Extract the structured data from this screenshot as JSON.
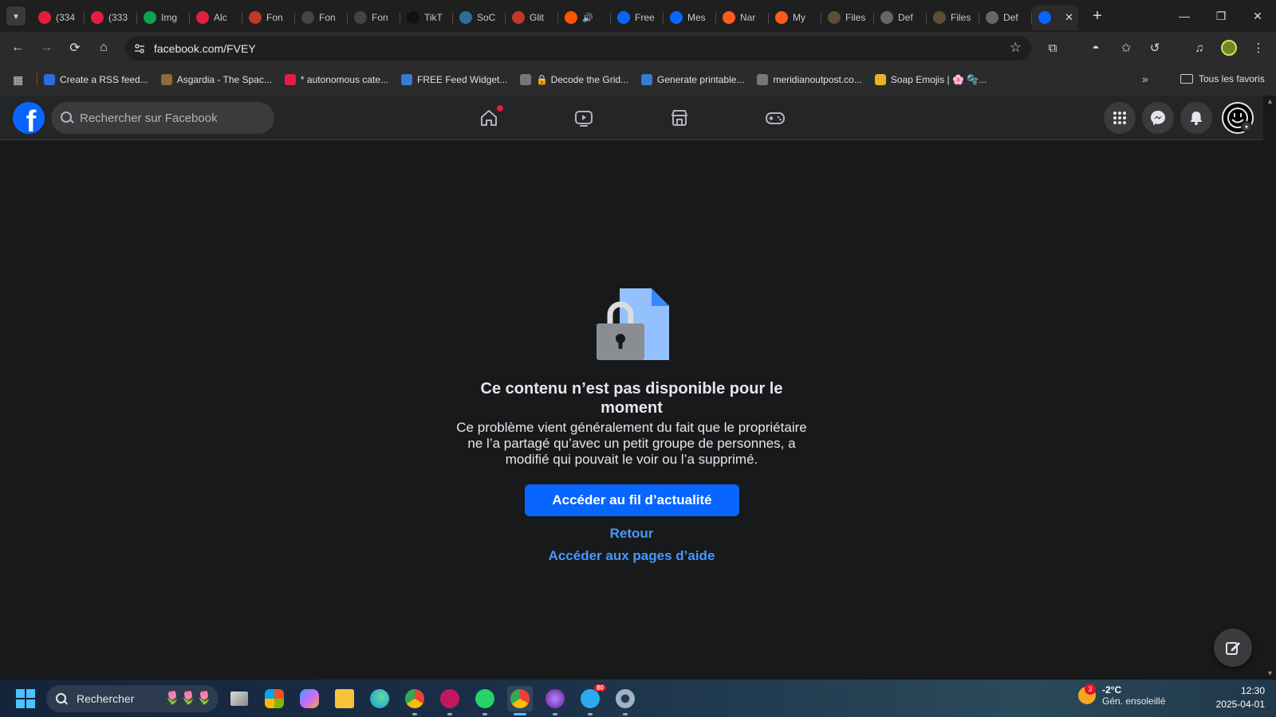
{
  "browser": {
    "tabs": [
      {
        "title": "(334",
        "favicon": "3k-badge-icon",
        "color": "#e41e3f"
      },
      {
        "title": "(333",
        "favicon": "3k-badge-icon",
        "color": "#e41e3f"
      },
      {
        "title": "Img",
        "favicon": "image-icon",
        "color": "#12a150"
      },
      {
        "title": "Alc",
        "favicon": "adobe-icon",
        "color": "#e41e3f"
      },
      {
        "title": "Fon",
        "favicon": "font-icon",
        "color": "#c0392b"
      },
      {
        "title": "Fon",
        "favicon": "font-icon",
        "color": "#444444"
      },
      {
        "title": "Fon",
        "favicon": "font-icon",
        "color": "#444444"
      },
      {
        "title": "TikT",
        "favicon": "tiktok-icon",
        "color": "#111111"
      },
      {
        "title": "SoC",
        "favicon": "gear-icon",
        "color": "#2a6f97"
      },
      {
        "title": "Glit",
        "favicon": "glitter-icon",
        "color": "#c0392b"
      },
      {
        "title": "",
        "favicon": "soundcloud-icon",
        "color": "#ff5500",
        "audio": "🔊"
      },
      {
        "title": "Free",
        "favicon": "facebook-icon",
        "color": "#0866ff"
      },
      {
        "title": "Mes",
        "favicon": "facebook-icon",
        "color": "#0866ff"
      },
      {
        "title": "Nar",
        "favicon": "n-icon",
        "color": "#ff5a1f"
      },
      {
        "title": "My",
        "favicon": "n-icon",
        "color": "#ff5a1f"
      },
      {
        "title": "Files",
        "favicon": "emblem-icon",
        "color": "#5d4e37"
      },
      {
        "title": "Def",
        "favicon": "globe-icon",
        "color": "#666666"
      },
      {
        "title": "Files",
        "favicon": "emblem-icon",
        "color": "#5d4e37"
      },
      {
        "title": "Def",
        "favicon": "globe-icon",
        "color": "#666666"
      }
    ],
    "active_tab": {
      "favicon": "facebook-icon",
      "color": "#0866ff",
      "close": "✕"
    },
    "new_tab": "+",
    "window_controls": {
      "minimize": "—",
      "restore": "❐",
      "close": "✕"
    },
    "address": {
      "url": "facebook.com/FVEY",
      "back": "←",
      "forward": "→",
      "reload": "⟳",
      "home": "⌂"
    },
    "bookmarks": [
      {
        "label": "Create a RSS feed...",
        "icon": "rss-icon",
        "color": "#2d6cdf"
      },
      {
        "label": "Asgardia - The Spac...",
        "icon": "asgardia-icon",
        "color": "#8a6d3b"
      },
      {
        "label": "* autonomous cate...",
        "icon": "adobe-icon",
        "color": "#e41e3f"
      },
      {
        "label": "FREE Feed Widget...",
        "icon": "widget-icon",
        "color": "#3a7bd5"
      },
      {
        "label": "🔒 Decode the Grid...",
        "icon": "globe-icon",
        "color": "#777777"
      },
      {
        "label": "Generate printable...",
        "icon": "printable-icon",
        "color": "#3a7bd5"
      },
      {
        "label": "meridianoutpost.co...",
        "icon": "globe-icon",
        "color": "#777777"
      },
      {
        "label": "Soap Emojis | 🌸 🫧...",
        "icon": "folder-icon",
        "color": "#e6b422"
      }
    ],
    "bookmarks_more": "»",
    "all_bookmarks": "Tous les favoris"
  },
  "facebook": {
    "search_placeholder": "Rechercher sur Facebook",
    "logo_letter": "f",
    "error": {
      "title": "Ce contenu n’est pas disponible pour le moment",
      "body": "Ce problème vient généralement du fait que le propriétaire ne l’a partagé qu’avec un petit groupe de personnes, a modifié qui pouvait le voir ou l’a supprimé.",
      "primary_button": "Accéder au fil d’actualité",
      "back_link": "Retour",
      "help_link": "Accéder aux pages d’aide"
    },
    "colors": {
      "brand": "#0866ff",
      "link": "#4599ff",
      "bg": "#18191a",
      "header": "#242526"
    }
  },
  "taskbar": {
    "search_text": "Rechercher",
    "weather": {
      "temp": "-2°C",
      "desc": "Gén. ensoleillé",
      "badge": "3"
    },
    "clock": {
      "time": "12:30",
      "date": "2025-04-01"
    },
    "telegram_badge": "80"
  }
}
